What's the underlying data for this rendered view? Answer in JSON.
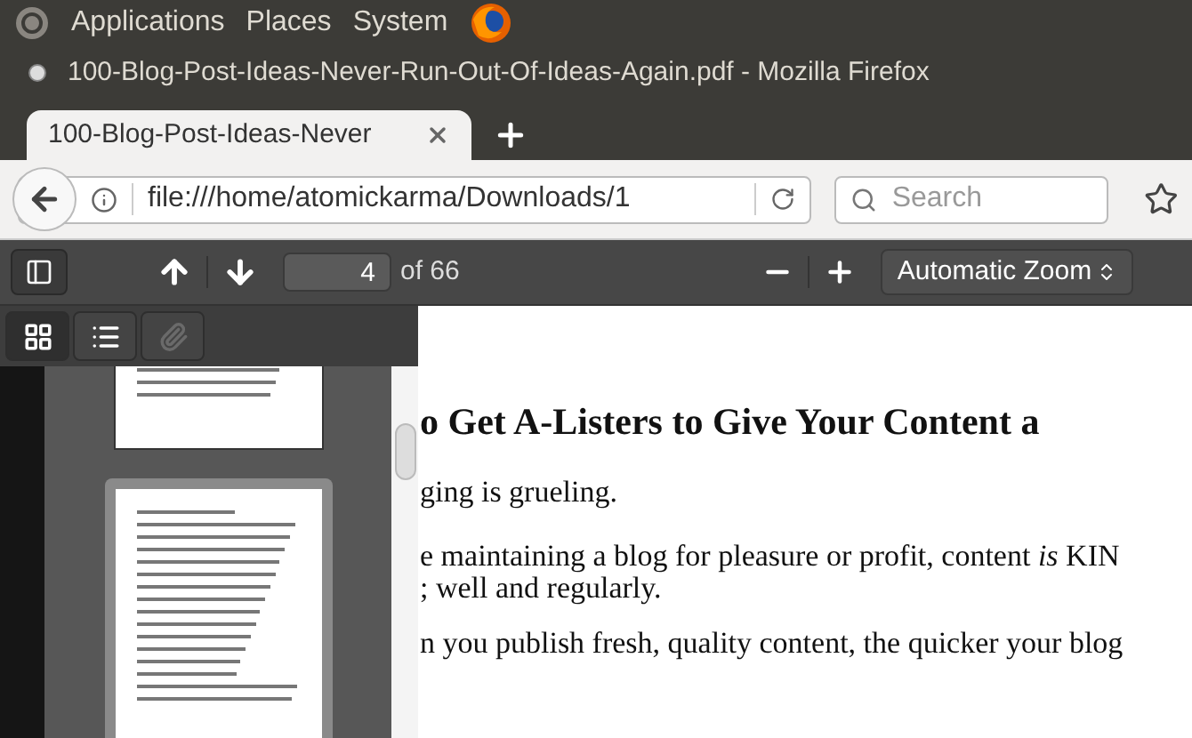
{
  "top_panel": {
    "menus": [
      "Applications",
      "Places",
      "System"
    ]
  },
  "window": {
    "title": "100-Blog-Post-Ideas-Never-Run-Out-Of-Ideas-Again.pdf - Mozilla Firefox"
  },
  "tabs": [
    {
      "label": "100-Blog-Post-Ideas-Never",
      "selected": true
    }
  ],
  "address_bar": {
    "value": "file:///home/atomickarma/Downloads/1"
  },
  "search": {
    "placeholder": "Search"
  },
  "pdf_toolbar": {
    "page": "4",
    "page_count": "of 66",
    "zoom": "Automatic Zoom"
  },
  "sidebar": {
    "views": [
      {
        "kind": "thumbnails",
        "selected": true,
        "disabled": false
      },
      {
        "kind": "outline",
        "selected": false,
        "disabled": false
      },
      {
        "kind": "attachments",
        "selected": false,
        "disabled": true
      }
    ],
    "thumbnails": [
      {
        "selected": false
      },
      {
        "selected": true
      }
    ]
  },
  "document": {
    "heading": "o Get A-Listers to Give Your Content a",
    "lines": [
      "ging is grueling.",
      "e maintaining a blog for pleasure or profit, content *is* KIN",
      "; well and regularly.",
      "n you publish fresh, quality content, the quicker your blog"
    ]
  }
}
